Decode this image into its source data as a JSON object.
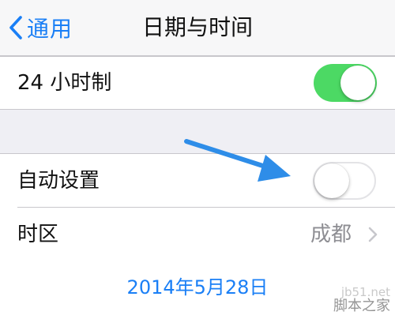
{
  "nav": {
    "back_label": "通用",
    "title": "日期与时间"
  },
  "settings": {
    "hour24": {
      "label": "24 小时制",
      "on": true
    },
    "auto_set": {
      "label": "自动设置",
      "on": false
    },
    "time_zone": {
      "label": "时区",
      "value": "成都"
    },
    "date": {
      "value": "2014年5月28日"
    }
  },
  "watermark": {
    "domain": "jb51.net",
    "name": "脚本之家"
  },
  "colors": {
    "accent": "#1a7ff6",
    "switch_on": "#4cd964",
    "annotation_arrow": "#2e8de8"
  },
  "icons": [
    "chevron-left-icon",
    "chevron-right-icon",
    "arrow-annotation-icon"
  ]
}
